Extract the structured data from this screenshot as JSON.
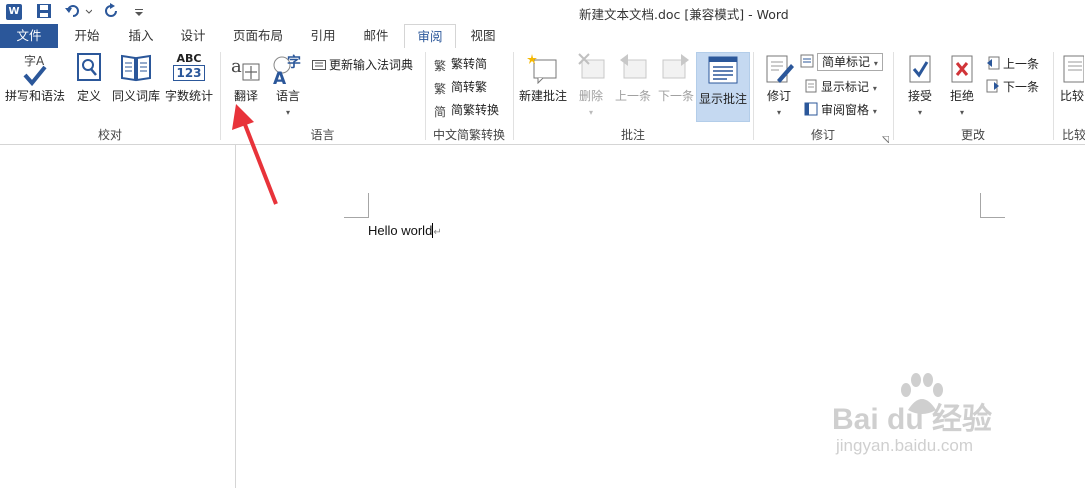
{
  "titlebar": {
    "title": "新建文本文档.doc [兼容模式] - Word",
    "logo_letter": "W"
  },
  "tabs": [
    {
      "label": "文件"
    },
    {
      "label": "开始"
    },
    {
      "label": "插入"
    },
    {
      "label": "设计"
    },
    {
      "label": "页面布局"
    },
    {
      "label": "引用"
    },
    {
      "label": "邮件"
    },
    {
      "label": "审阅"
    },
    {
      "label": "视图"
    }
  ],
  "groups": {
    "proofing": {
      "label": "校对",
      "spelling": "拼写和语法",
      "define": "定义",
      "thesaurus": "同义词库",
      "wordcount": "字数统计",
      "spelling_icon_text": "字A",
      "wordcount_icon_top": "ABC",
      "wordcount_icon_bottom": "123"
    },
    "language": {
      "label": "语言",
      "translate": "翻译",
      "language": "语言",
      "update_ime": "更新输入法词典",
      "language_icon_text": "字"
    },
    "chinese": {
      "label": "中文简繁转换",
      "to_simplified": "繁转简",
      "to_traditional": "简转繁",
      "convert": "简繁转换",
      "icon_fan": "繁",
      "icon_jian": "简"
    },
    "comments": {
      "label": "批注",
      "new": "新建批注",
      "delete": "删除",
      "previous": "上一条",
      "next": "下一条",
      "show": "显示批注"
    },
    "tracking": {
      "label": "修订",
      "track": "修订",
      "markup_select": "简单标记",
      "show_markup": "显示标记",
      "review_pane": "审阅窗格"
    },
    "changes": {
      "label": "更改",
      "accept": "接受",
      "reject": "拒绝",
      "previous": "上一条",
      "next": "下一条"
    },
    "compare": {
      "label": "比较",
      "compare": "比较"
    }
  },
  "document": {
    "text": "Hello world",
    "para_mark": "↵"
  },
  "watermark": {
    "brand": "Bai du 经验",
    "url": "jingyan.baidu.com"
  },
  "colors": {
    "accent": "#2b579a",
    "arrow": "#e8333a",
    "highlight": "#c5d9f1"
  }
}
